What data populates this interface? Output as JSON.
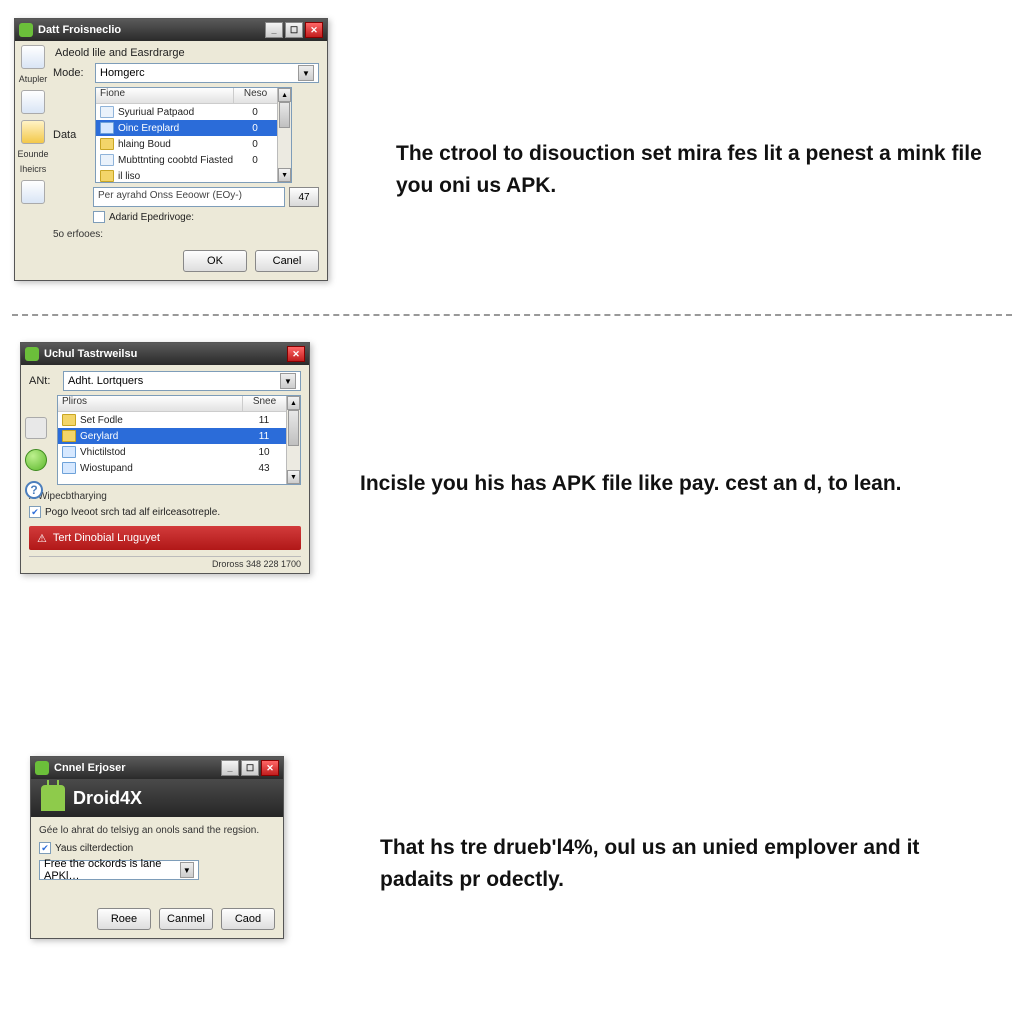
{
  "captions": {
    "c1": "The ctrool to disouction set mira fes lit a penest a mink file you oni us APK.",
    "c2": "Incisle you his has APK file like pay. cest an d, to lean.",
    "c3": "That hs tre drueb'l4%, oul us an unied emplover and it padaits pr odectly."
  },
  "panel1": {
    "title": "Datt Froisneclio",
    "header": "Adeold lile and Easrdrarge",
    "mode_label": "Mode:",
    "mode_value": "Homgerc",
    "data_label": "Data",
    "side": {
      "lbl1": "Atupler",
      "lbl2": "Eounde",
      "lbl3": "Iheicrs"
    },
    "list": {
      "col1": "Fione",
      "col2": "Neso",
      "rows": [
        {
          "name": "Syuriual Patpaod",
          "val": "0",
          "icon": "page"
        },
        {
          "name": "Oinc Ereplard",
          "val": "0",
          "sel": true,
          "icon": "reg"
        },
        {
          "name": "hlaing Boud",
          "val": "0",
          "icon": "folder"
        },
        {
          "name": "Mubttnting coobtd Fiasted",
          "val": "0",
          "icon": "page"
        },
        {
          "name": "il liso",
          "val": "",
          "icon": "folder"
        }
      ]
    },
    "textbox": "Per ayrahd Onss Eeoowr (EOy-)",
    "smallbtn": "47",
    "checkbox": "Adarid Epedrivoge:",
    "footer": "5o erfooes:",
    "ok": "OK",
    "cancel": "Canel"
  },
  "panel2": {
    "title": "Uchul Tastrweilsu",
    "ant_label": "ANt:",
    "combo": "Adht. Lortquers",
    "list": {
      "col1": "Pliros",
      "col2": "Snee",
      "rows": [
        {
          "name": "Set Fodle",
          "val": "11",
          "icon": "folder"
        },
        {
          "name": "Gerylard",
          "val": "11",
          "sel": true,
          "icon": "folder"
        },
        {
          "name": "Vhictilstod",
          "val": "10",
          "icon": "reg"
        },
        {
          "name": "Wiostupand",
          "val": "43",
          "icon": "reg"
        }
      ]
    },
    "section": "A Wipecbtharying",
    "checkbox": "Pogo lveoot srch tad alf eirlceasotreple.",
    "redbtn": "Tert Dinobial Lruguyet",
    "status": "Droross  348   228  1700"
  },
  "panel3": {
    "title": "Cnnel Erjoser",
    "brand": "Droid4X",
    "desc": "Gée lo ahrat do telsiyg an onols sand the regsion.",
    "checkbox": "Yaus cilterdection",
    "combo": "Free the ockords is lane APKl…",
    "btn1": "Roee",
    "btn2": "Canmel",
    "btn3": "Caod"
  }
}
